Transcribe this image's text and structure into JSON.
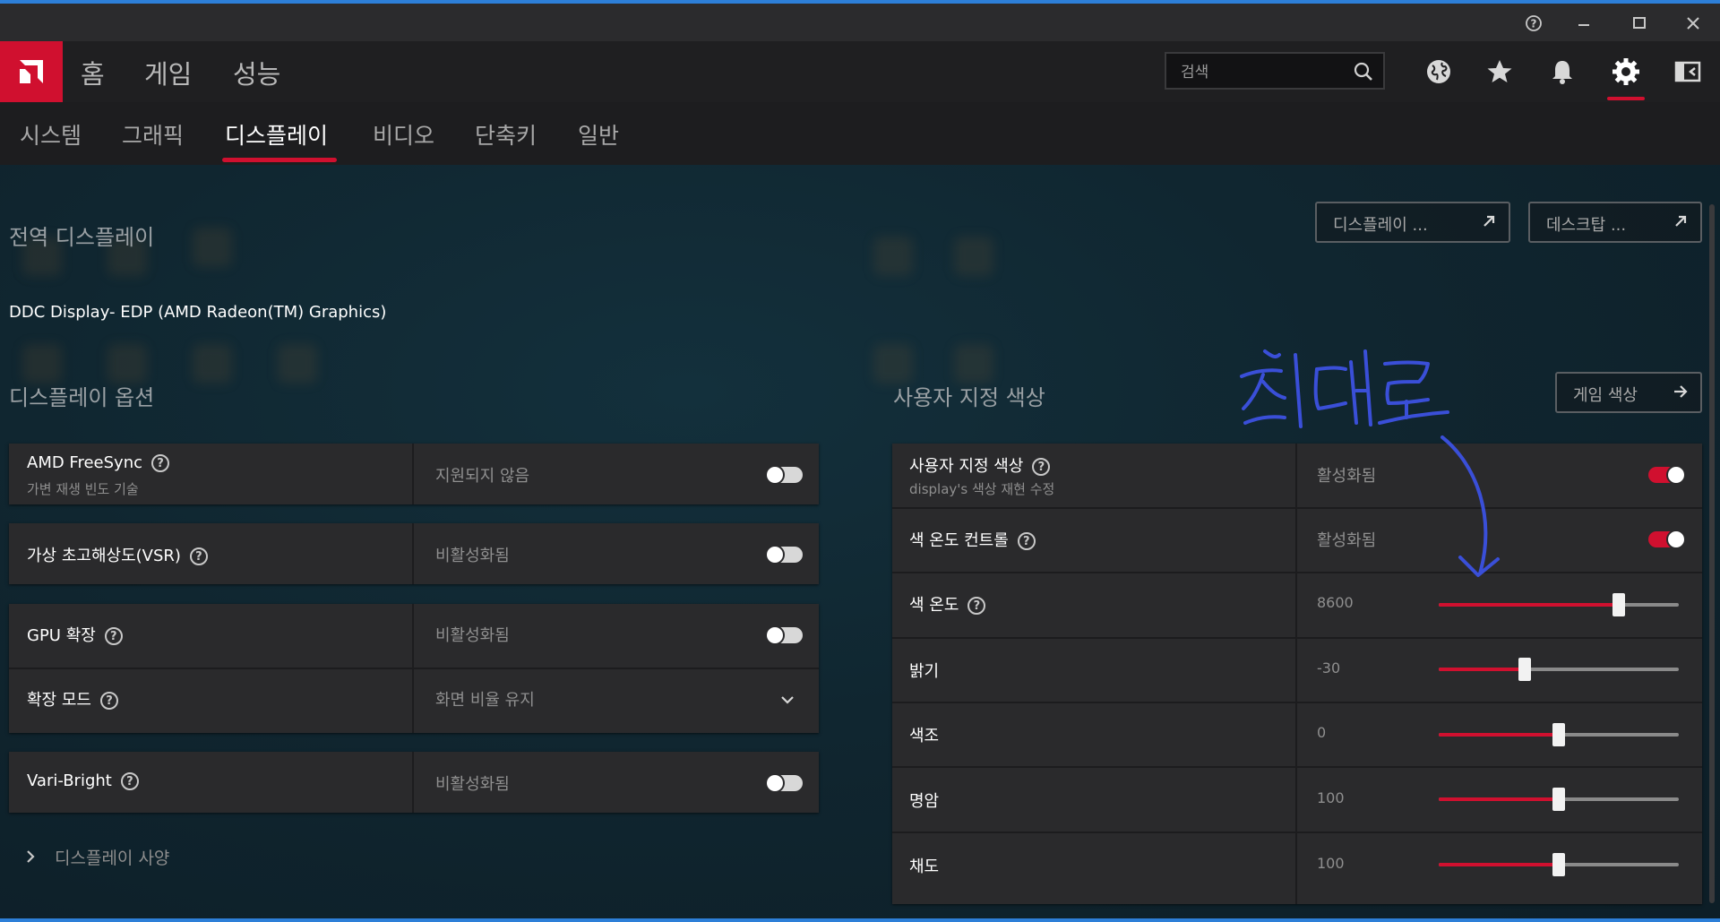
{
  "window": {
    "help_glyph": "?"
  },
  "nav": {
    "main": [
      "홈",
      "게임",
      "성능"
    ],
    "search_placeholder": "검색",
    "sub": [
      "시스템",
      "그래픽",
      "디스플레이",
      "비디오",
      "단축키",
      "일반"
    ],
    "sub_active": "디스플레이"
  },
  "global_display": {
    "title": "전역 디스플레이",
    "display_button": "디스플레이 ...",
    "desktop_button": "데스크탑 ...",
    "display_name": "DDC Display- EDP (AMD Radeon(TM) Graphics)"
  },
  "display_options": {
    "title": "디스플레이 옵션",
    "items": [
      {
        "label": "AMD FreeSync",
        "sub": "가변 재생 빈도 기술",
        "value": "지원되지 않음",
        "control": "toggle",
        "on": false
      },
      {
        "label": "가상 초고해상도(VSR)",
        "value": "비활성화됨",
        "control": "toggle",
        "on": false
      },
      {
        "label": "GPU 확장",
        "value": "비활성화됨",
        "control": "toggle",
        "on": false
      },
      {
        "label": "확장 모드",
        "value": "화면 비율 유지",
        "control": "dropdown"
      },
      {
        "label": "Vari-Bright",
        "value": "비활성화됨",
        "control": "toggle",
        "on": false
      }
    ],
    "specs_link": "디스플레이 사양"
  },
  "custom_color": {
    "title": "사용자 지정 색상",
    "game_color_button": "게임 색상",
    "rows": [
      {
        "label": "사용자 지정 색상",
        "sub": "display's 색상 재현 수정",
        "value": "활성화됨",
        "control": "toggle",
        "on": true
      },
      {
        "label": "색 온도 컨트롤",
        "value": "활성화됨",
        "control": "toggle",
        "on": true
      },
      {
        "label": "색 온도",
        "value": "8600",
        "control": "slider",
        "fraction": 0.75
      },
      {
        "label": "밝기",
        "value": "-30",
        "control": "slider",
        "fraction": 0.36
      },
      {
        "label": "색조",
        "value": "0",
        "control": "slider",
        "fraction": 0.5
      },
      {
        "label": "명암",
        "value": "100",
        "control": "slider",
        "fraction": 0.5
      },
      {
        "label": "채도",
        "value": "100",
        "control": "slider",
        "fraction": 0.5
      }
    ]
  },
  "annotation": {
    "handwriting": "최대로",
    "color": "#3a4fd8"
  },
  "colors": {
    "accent": "#d0102f",
    "window_border": "#2d7fd8"
  }
}
